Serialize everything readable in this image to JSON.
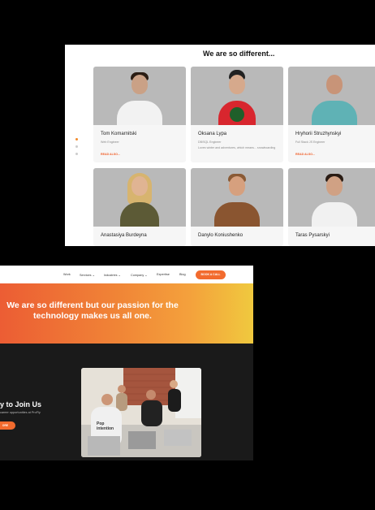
{
  "team_section": {
    "title": "We are so different...",
    "members": [
      {
        "name": "Tom Komarnitski",
        "role": "Web Engineer",
        "bio": "",
        "more": "READ ALSO..."
      },
      {
        "name": "Oksana Lypa",
        "role": "DB/SQL Engineer",
        "bio": "Loves winter and adventures, which means... snowboarding",
        "more": ""
      },
      {
        "name": "Hryhorii Struzhynskyi",
        "role": "Full Stack JS Engineer",
        "bio": "",
        "more": "READ ALSO..."
      },
      {
        "name": "Anastasiya Burdeyna",
        "role": "",
        "bio": "",
        "more": ""
      },
      {
        "name": "Danylo Koniushenko",
        "role": "",
        "bio": "",
        "more": ""
      },
      {
        "name": "Taras Pysarskyi",
        "role": "",
        "bio": "",
        "more": ""
      }
    ]
  },
  "landing": {
    "nav": {
      "items": [
        "Work",
        "Services ⌄",
        "Industries ⌄",
        "Company ⌄",
        "Expertise",
        "Blog"
      ],
      "cta": "BOOK A CALL"
    },
    "hero": {
      "line1": "We are so different but our passion for the",
      "line2": "technology makes us all one."
    },
    "join": {
      "title": "y to Join Us",
      "subtitle": "career opportunities at ProFly",
      "button": "ORE"
    },
    "shirt_text": "Pop intention"
  }
}
